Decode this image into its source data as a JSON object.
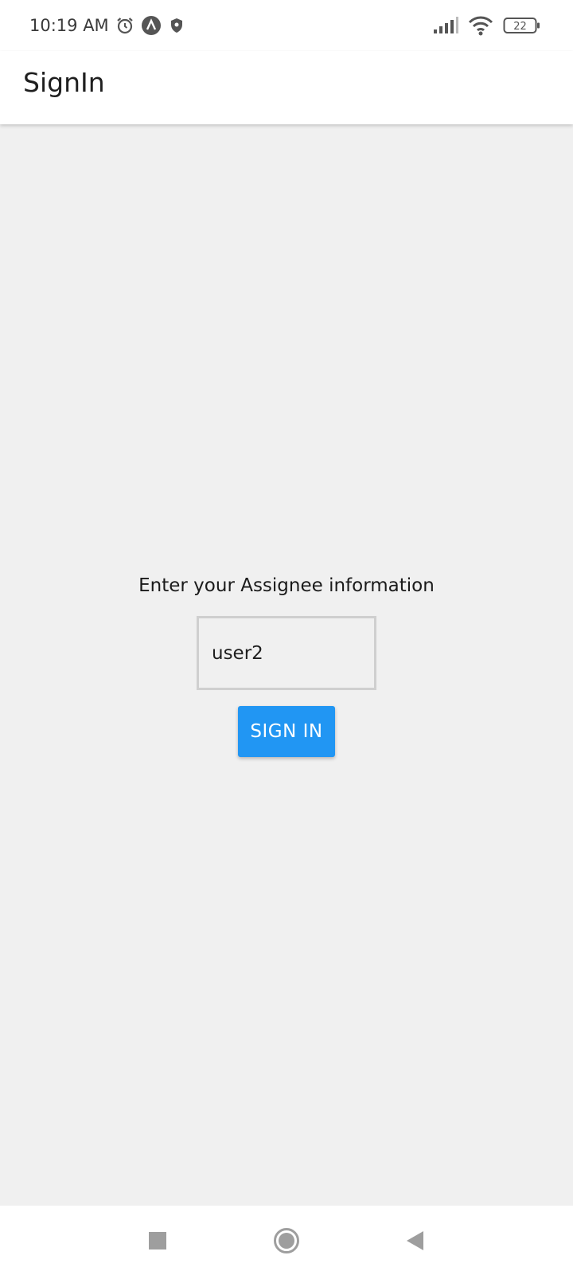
{
  "status_bar": {
    "time": "10:19 AM",
    "battery_level": "22",
    "icons": [
      "alarm-icon",
      "app-notification-icon",
      "shield-icon",
      "signal-icon",
      "wifi-icon",
      "battery-icon"
    ]
  },
  "app_bar": {
    "title": "SignIn"
  },
  "form": {
    "prompt": "Enter your Assignee information",
    "assignee_value": "user2",
    "sign_in_label": "SIGN IN"
  },
  "colors": {
    "accent": "#2196f3",
    "background": "#f0f0f0",
    "input_border": "#cfcfcf"
  },
  "nav_bar": {
    "buttons": [
      "recents-icon",
      "home-icon",
      "back-icon"
    ]
  }
}
